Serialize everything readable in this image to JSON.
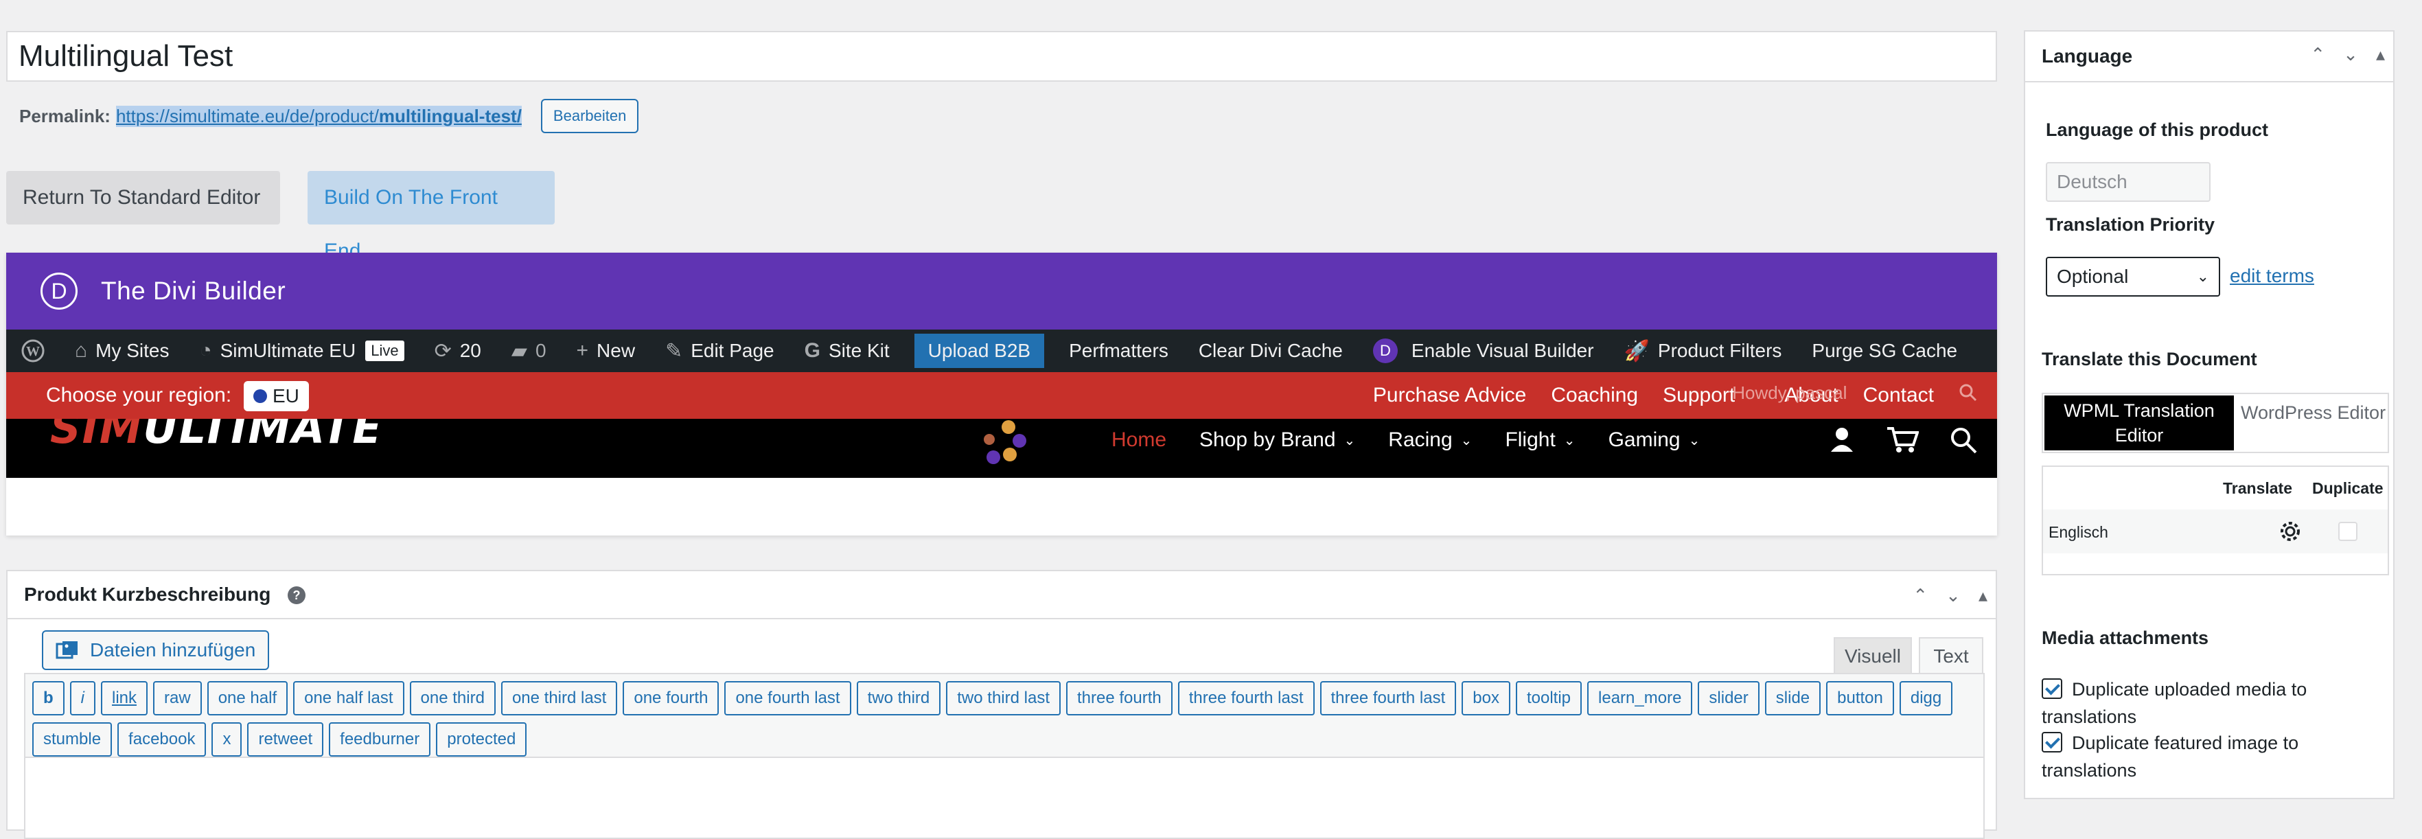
{
  "post_title": "Multilingual Test",
  "permalink": {
    "label": "Permalink:",
    "url_base": "https://simultimate.eu/de/product/",
    "url_slug": "multilingual-test/",
    "edit_label": "Bearbeiten"
  },
  "builder_buttons": {
    "return_label": "Return To Standard Editor",
    "front_end_label": "Build On The Front End"
  },
  "divi": {
    "logo_letter": "D",
    "title": "The Divi Builder"
  },
  "admin_bar": {
    "my_sites": "My Sites",
    "site_name": "SimUltimate EU",
    "live_badge": "Live",
    "updates_count": "20",
    "comments_count": "0",
    "new": "New",
    "edit_page": "Edit Page",
    "site_kit": "Site Kit",
    "upload_b2b": "Upload B2B",
    "perfmatters": "Perfmatters",
    "clear_cache": "Clear Divi Cache",
    "visual_builder": "Enable Visual Builder",
    "product_filters": "Product Filters",
    "purge_cache": "Purge SG Cache"
  },
  "site_topbar": {
    "region_label": "Choose your region:",
    "region_value": "EU",
    "links": [
      "Purchase Advice",
      "Coaching",
      "Support",
      "About",
      "Contact"
    ],
    "overlap_text": "Howdy, pascal"
  },
  "site_nav": {
    "logo_prefix": "SIM",
    "logo_rest": "ULTIMATE",
    "items": [
      {
        "label": "Home",
        "active": true
      },
      {
        "label": "Shop by Brand",
        "dropdown": true
      },
      {
        "label": "Racing",
        "dropdown": true
      },
      {
        "label": "Flight",
        "dropdown": true
      },
      {
        "label": "Gaming",
        "dropdown": true
      }
    ]
  },
  "short_description": {
    "title": "Produkt Kurzbeschreibung",
    "help": "?",
    "add_media": "Dateien hinzufügen",
    "tab_visual": "Visuell",
    "tab_text": "Text",
    "quicktags": [
      "b",
      "i",
      "link",
      "raw",
      "one half",
      "one half last",
      "one third",
      "one third last",
      "one fourth",
      "one fourth last",
      "two third",
      "two third last",
      "three fourth",
      "three fourth last",
      "three fourth last",
      "box",
      "tooltip",
      "learn_more",
      "slider",
      "slide",
      "button",
      "digg",
      "stumble",
      "facebook",
      "x",
      "retweet",
      "feedburner",
      "protected"
    ]
  },
  "language_panel": {
    "title": "Language",
    "language_label": "Language of this product",
    "language_value": "Deutsch",
    "priority_label": "Translation Priority",
    "priority_value": "Optional",
    "edit_terms": "edit terms",
    "translate_label": "Translate this Document",
    "tab_wpml": "WPML Translation Editor",
    "tab_wp": "WordPress Editor",
    "col_translate": "Translate",
    "col_duplicate": "Duplicate",
    "row_language": "Englisch",
    "media_label": "Media attachments",
    "dup_media": "Duplicate uploaded media to translations",
    "dup_image": "Duplicate featured image to translations"
  },
  "colors": {
    "divi_purple": "#6034b3",
    "admin_bar": "#1d2327",
    "site_red": "#c7302a",
    "wp_blue": "#2271b1"
  }
}
